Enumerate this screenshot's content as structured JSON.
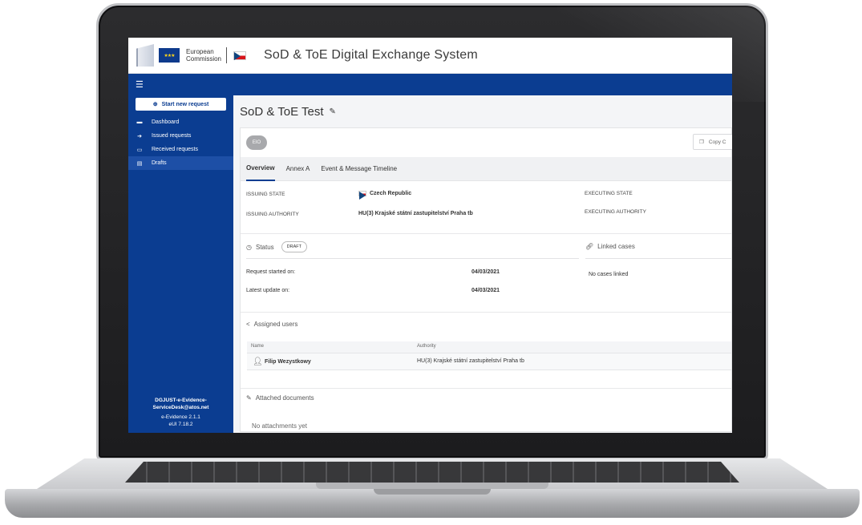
{
  "header": {
    "ec_line1": "European",
    "ec_line2": "Commission",
    "title": "SoD & ToE Digital Exchange System"
  },
  "icons": {
    "menu": "hamburger-icon",
    "start": "plus-circle-icon",
    "dashboard": "dashboard-icon",
    "issued": "arrow-right-icon",
    "received": "inbox-icon",
    "drafts": "document-icon",
    "edit": "pencil-icon",
    "copy": "copy-icon",
    "status": "clock-icon",
    "linked": "link-icon",
    "assigned": "share-icon",
    "user": "person-icon",
    "attached": "paperclip-icon"
  },
  "colors": {
    "primary": "#0b3d91",
    "sidebar_active": "#1d4fa6"
  },
  "sidebar": {
    "start_label": "Start new request",
    "items": [
      {
        "label": "Dashboard"
      },
      {
        "label": "Issued requests"
      },
      {
        "label": "Received requests"
      },
      {
        "label": "Drafts",
        "active": true
      }
    ],
    "footer_email_line1": "DGJUST-e-Evidence-",
    "footer_email_line2": "ServiceDesk@atos.net",
    "footer_version": "e-Evidence 2.1.1",
    "footer_eui": "eUI 7.18.2"
  },
  "page": {
    "title": "SoD & ToE Test",
    "badge": "EIO",
    "copy_label": "Copy C"
  },
  "tabs": [
    {
      "label": "Overview",
      "active": true
    },
    {
      "label": "Annex A"
    },
    {
      "label": "Event & Message Timeline"
    }
  ],
  "overview": {
    "issuing_state_label": "ISSUING STATE",
    "issuing_state_value": "Czech Republic",
    "issuing_authority_label": "ISSUING AUTHORITY",
    "issuing_authority_value": "HU(3) Krajské státní zastupitelství Praha tb",
    "executing_state_label": "EXECUTING STATE",
    "executing_authority_label": "EXECUTING AUTHORITY"
  },
  "status": {
    "heading": "Status",
    "pill": "DRAFT",
    "started_label": "Request started on:",
    "started_value": "04/03/2021",
    "updated_label": "Latest update on:",
    "updated_value": "04/03/2021"
  },
  "linked": {
    "heading": "Linked cases",
    "empty": "No cases linked"
  },
  "assigned": {
    "heading": "Assigned users",
    "col_name": "Name",
    "col_authority": "Authority",
    "rows": [
      {
        "name": "Filip Wezystkowy",
        "authority": "HU(3) Krajské státní zastupitelství Praha tb"
      }
    ]
  },
  "attached": {
    "heading": "Attached documents",
    "empty": "No attachments yet"
  }
}
